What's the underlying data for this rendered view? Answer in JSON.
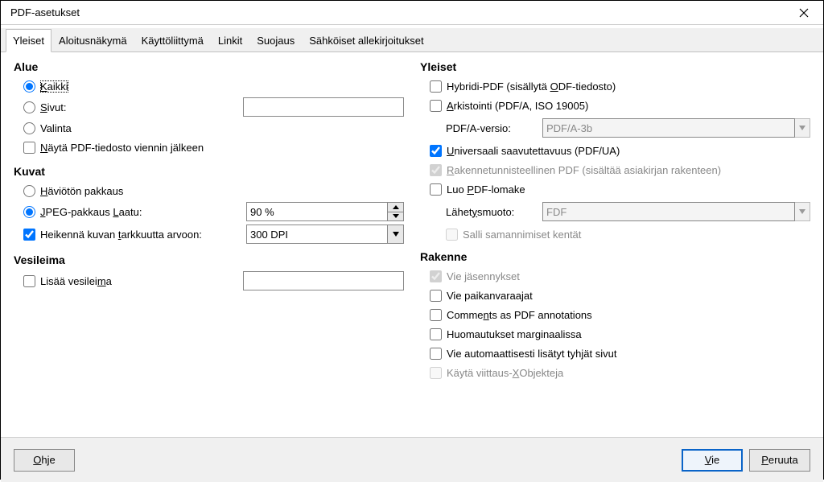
{
  "window": {
    "title": "PDF-asetukset"
  },
  "tabs": {
    "general": "Yleiset",
    "initial_view": "Aloitusnäkymä",
    "ui": "Käyttöliittymä",
    "links": "Linkit",
    "security": "Suojaus",
    "signatures": "Sähköiset allekirjoitukset"
  },
  "range": {
    "heading": "Alue",
    "all": "Kaikki",
    "pages": "Sivut:",
    "pages_value": "",
    "selection": "Valinta",
    "view_after": "Näytä PDF-tiedosto viennin jälkeen"
  },
  "images": {
    "heading": "Kuvat",
    "lossless": "Häviötön pakkaus",
    "jpeg": "JPEG-pakkaus Laatu:",
    "jpeg_value": "90 %",
    "reduce": "Heikennä kuvan tarkkuutta arvoon:",
    "reduce_value": "300 DPI"
  },
  "watermark": {
    "heading": "Vesileima",
    "add": "Lisää vesileima",
    "value": ""
  },
  "general": {
    "heading": "Yleiset",
    "hybrid": "Hybridi-PDF (sisällytä ODF-tiedosto)",
    "archive": "Arkistointi (PDF/A, ISO 19005)",
    "pdfa_label": "PDF/A-versio:",
    "pdfa_value": "PDF/A-3b",
    "ua": "Universaali saavutettavuus (PDF/UA)",
    "tagged": "Rakennetunnisteellinen PDF (sisältää asiakirjan rakenteen)",
    "form": "Luo PDF-lomake",
    "submit_label": "Lähetysmuoto:",
    "submit_value": "FDF",
    "dup_fields": "Salli samannimiset kentät"
  },
  "structure": {
    "heading": "Rakenne",
    "outlines": "Vie jäsennykset",
    "placeholders": "Vie paikanvaraajat",
    "comments": "Comments as PDF annotations",
    "notes_margin": "Huomautukset marginaalissa",
    "auto_blank": "Vie automaattisesti lisätyt tyhjät sivut",
    "xobjects": "Käytä viittaus-XObjekteja"
  },
  "footer": {
    "help": "Ohje",
    "export": "Vie",
    "cancel": "Peruuta"
  }
}
